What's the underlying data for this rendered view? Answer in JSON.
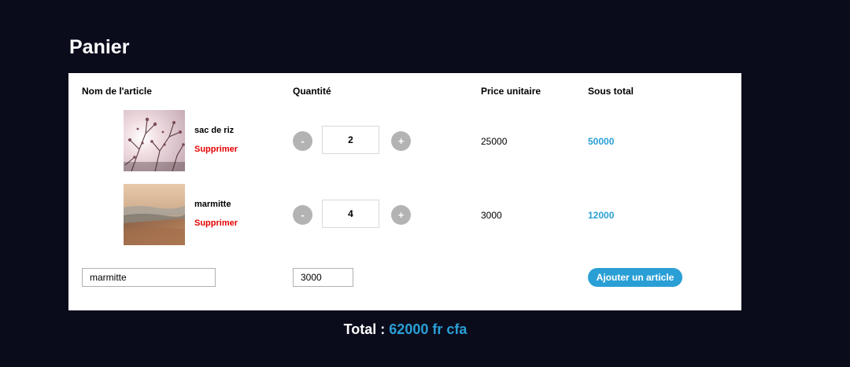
{
  "page": {
    "title": "Panier"
  },
  "table": {
    "headers": {
      "item": "Nom de l'article",
      "quantity": "Quantité",
      "unit_price": "Price unitaire",
      "subtotal": "Sous total"
    }
  },
  "items": [
    {
      "name": "sac de riz",
      "remove_label": "Supprimer",
      "quantity": "2",
      "unit_price": "25000",
      "subtotal": "50000",
      "decrement_label": "-",
      "increment_label": "+",
      "image": "blossom-branch-photo"
    },
    {
      "name": "marmitte",
      "remove_label": "Supprimer",
      "quantity": "4",
      "unit_price": "3000",
      "subtotal": "12000",
      "decrement_label": "-",
      "increment_label": "+",
      "image": "landscape-photo"
    }
  ],
  "add_form": {
    "name_value": "marmitte",
    "price_value": "3000",
    "add_label": "Ajouter un article"
  },
  "total": {
    "label": "Total :",
    "value": "62000 fr cfa"
  },
  "colors": {
    "background": "#0a0c1c",
    "accent": "#2a9fd6",
    "danger": "#e60000",
    "qty_button": "#b3b3b3"
  }
}
